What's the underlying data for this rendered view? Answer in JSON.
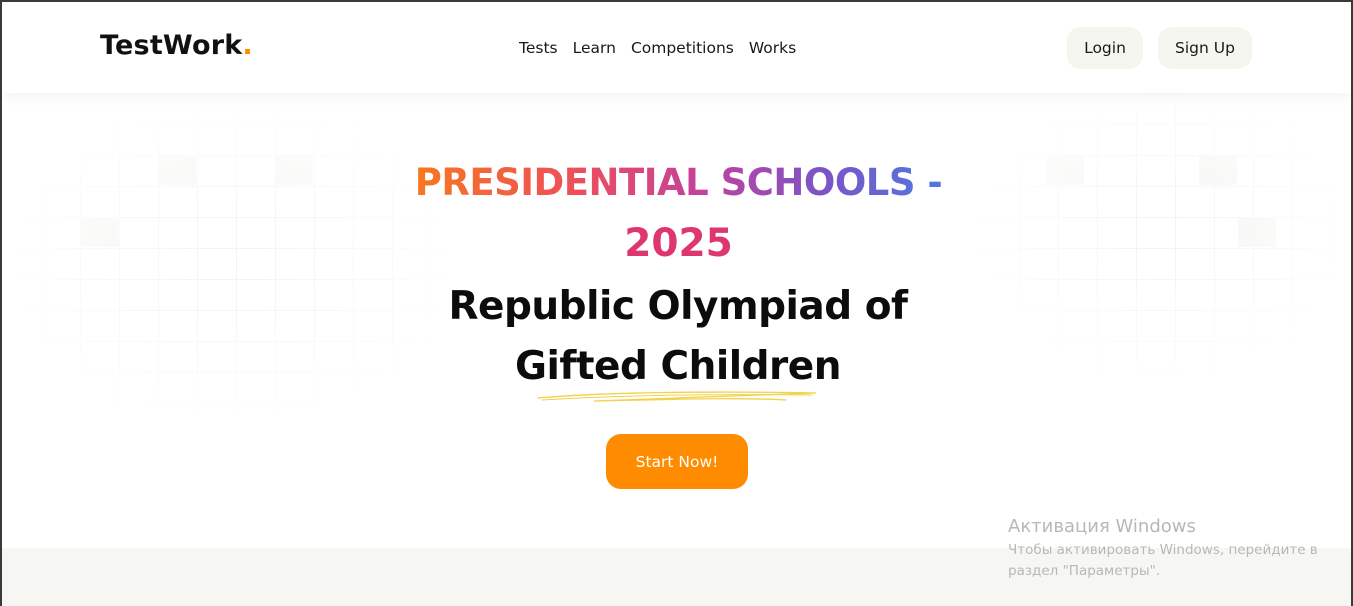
{
  "header": {
    "logo_text": "TestWork",
    "logo_dot": ".",
    "nav": [
      "Tests",
      "Learn",
      "Competitions",
      "Works"
    ],
    "login_label": "Login",
    "signup_label": "Sign Up"
  },
  "hero": {
    "title_line1": "PRESIDENTIAL SCHOOLS -",
    "title_line2": "2025",
    "subtitle": "Republic Olympiad of Gifted Children",
    "cta_label": "Start Now!"
  },
  "watermark": {
    "title": "Активация Windows",
    "text": "Чтобы активировать Windows, перейдите в раздел \"Параметры\"."
  },
  "colors": {
    "accent_orange": "#ff8c00",
    "gradient": [
      "#f7781f",
      "#ee4f5a",
      "#c2419d",
      "#7a55c7",
      "#4f79de"
    ],
    "year_pink": "#e0366f",
    "underline_yellow": "#f2d24a"
  }
}
